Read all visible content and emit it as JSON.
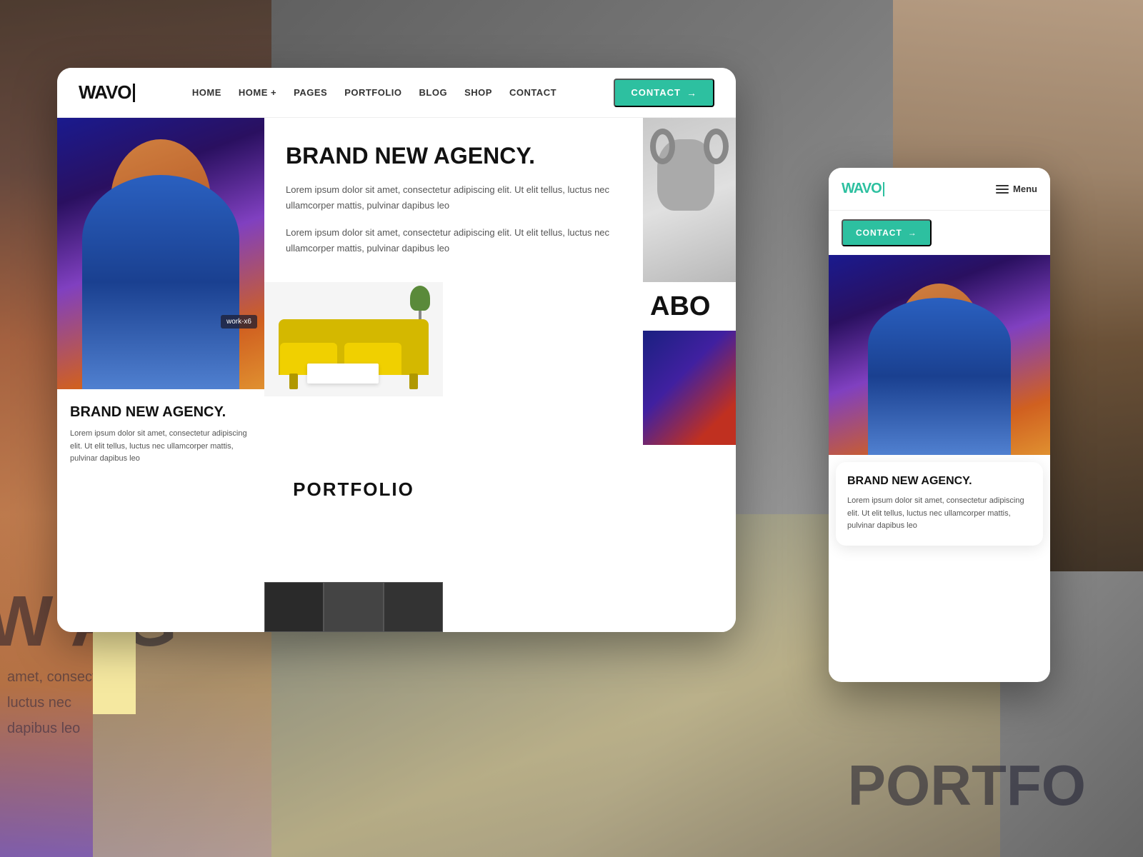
{
  "background": {
    "agency_text": "W AG",
    "lorem_line1": "amet, consectetur",
    "lorem_line2": "luctus nec",
    "lorem_line3": "dapibus leo",
    "portfolio_bottom": "PORTFO"
  },
  "desktop_card": {
    "logo": "WAVO",
    "nav": {
      "links": [
        "HOME",
        "HOME +",
        "PAGES",
        "PORTFOLIO",
        "BLOG",
        "SHOP",
        "CONTACT"
      ],
      "cta_label": "CONTACT",
      "cta_arrow": "→"
    },
    "hero": {
      "title": "BRAND NEW AGENCY.",
      "lorem1": "Lorem ipsum dolor sit amet, consectetur adipiscing elit. Ut elit tellus, luctus nec ullamcorper mattis, pulvinar dapibus leo",
      "lorem2": "Lorem ipsum dolor sit amet, consectetur adipiscing elit. Ut elit tellus, luctus nec ullamcorper mattis, pulvinar dapibus leo"
    },
    "work_badge": "work-x6",
    "bottom_left": {
      "title": "BRAND NEW AGENCY.",
      "desc": "Lorem ipsum dolor sit amet, consectetur adipiscing elit. Ut elit tellus, luctus nec ullamcorper mattis, pulvinar dapibus leo"
    },
    "portfolio": {
      "label": "PORTFOLIO"
    },
    "about": {
      "label": "ABO"
    }
  },
  "mobile_card": {
    "logo": "WAVO",
    "menu_label": "Menu",
    "cta_label": "CONTACT",
    "cta_arrow": "→",
    "bottom": {
      "title": "BRAND NEW AGENCY.",
      "desc": "Lorem ipsum dolor sit amet, consectetur adipiscing elit. Ut elit tellus, luctus nec ullamcorper mattis, pulvinar dapibus leo"
    }
  },
  "colors": {
    "teal": "#2dc0a0",
    "dark": "#111111",
    "light_gray": "#f5f5f5",
    "text_gray": "#555555",
    "yellow": "#f5e8a0"
  }
}
